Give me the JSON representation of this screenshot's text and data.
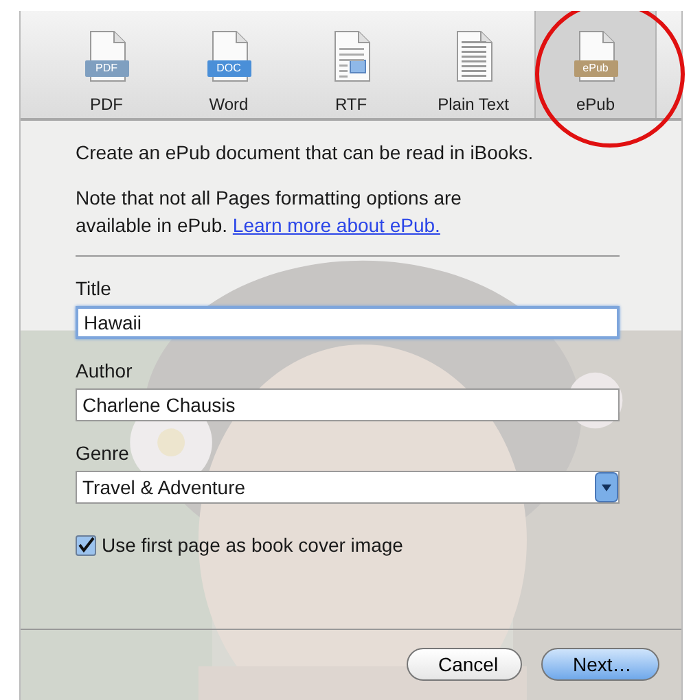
{
  "formats": [
    {
      "label": "PDF",
      "kind": "badge",
      "badge": "PDF",
      "color": "#7f9fc0",
      "selected": false
    },
    {
      "label": "Word",
      "kind": "badge",
      "badge": "DOC",
      "color": "#4a8fd8",
      "selected": false
    },
    {
      "label": "RTF",
      "kind": "rtf",
      "selected": false
    },
    {
      "label": "Plain Text",
      "kind": "text",
      "selected": false
    },
    {
      "label": "ePub",
      "kind": "badge",
      "badge": "ePub",
      "color": "#b59a70",
      "selected": true
    }
  ],
  "intro": "Create an ePub document that can be read in iBooks.",
  "note": "Note that not all Pages formatting options are available in ePub.",
  "note_link": "Learn more about ePub.",
  "fields": [
    {
      "label": "Title",
      "kind": "text",
      "value": "Hawaii",
      "focused": true
    },
    {
      "label": "Author",
      "kind": "text",
      "value": "Charlene Chausis",
      "focused": false
    },
    {
      "label": "Genre",
      "kind": "popup",
      "value": "Travel & Adventure",
      "focused": false
    }
  ],
  "cover_checkbox": {
    "label": "Use first page as book cover image",
    "checked": true
  },
  "buttons": [
    {
      "label": "Cancel",
      "default": false
    },
    {
      "label": "Next…",
      "default": true
    }
  ],
  "annotation": {
    "kind": "circle",
    "color": "#e01010"
  }
}
